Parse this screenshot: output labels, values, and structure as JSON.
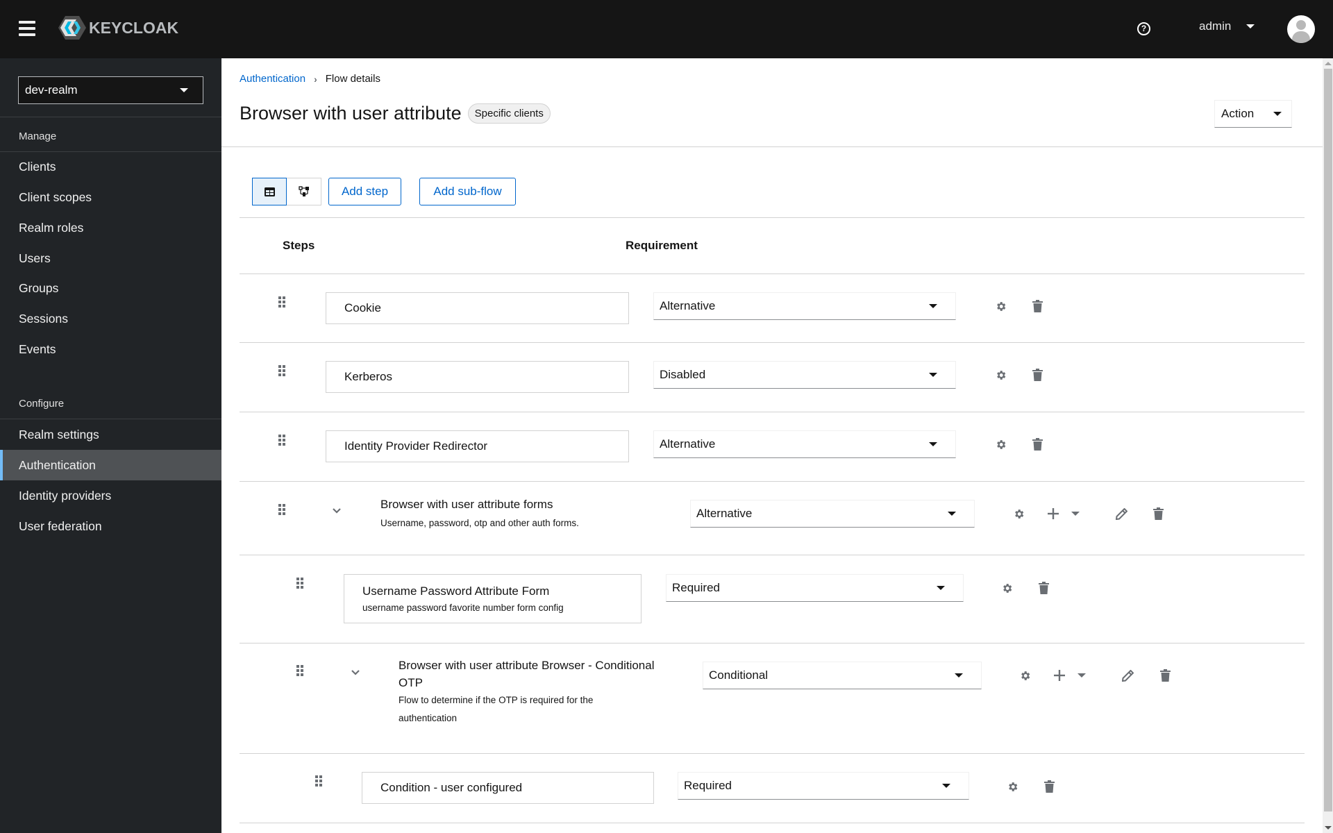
{
  "header": {
    "brand": "KEYCLOAK",
    "user": "admin",
    "icons": [
      "menu-icon",
      "help-icon",
      "avatar-icon"
    ]
  },
  "sidebar": {
    "realm": "dev-realm",
    "sections": [
      {
        "label": "Manage",
        "items": [
          "Clients",
          "Client scopes",
          "Realm roles",
          "Users",
          "Groups",
          "Sessions",
          "Events"
        ]
      },
      {
        "label": "Configure",
        "items": [
          "Realm settings",
          "Authentication",
          "Identity providers",
          "User federation"
        ]
      }
    ],
    "active_item": "Authentication"
  },
  "breadcrumb": {
    "parent": "Authentication",
    "current": "Flow details"
  },
  "page": {
    "title": "Browser with user attribute",
    "badge": "Specific clients",
    "action_label": "Action"
  },
  "toolbar": {
    "view_toggle": [
      "table-view",
      "diagram-view"
    ],
    "selected_view": "table-view",
    "add_step": "Add step",
    "add_subflow": "Add sub-flow"
  },
  "table": {
    "columns": [
      "Steps",
      "Requirement"
    ],
    "rows": [
      {
        "type": "step",
        "level": 0,
        "name": "Cookie",
        "requirement": "Alternative"
      },
      {
        "type": "step",
        "level": 0,
        "name": "Kerberos",
        "requirement": "Disabled"
      },
      {
        "type": "step",
        "level": 0,
        "name": "Identity Provider Redirector",
        "requirement": "Alternative"
      },
      {
        "type": "flow",
        "level": 0,
        "expanded": true,
        "name": "Browser with user attribute forms",
        "description": "Username, password, otp and other auth forms.",
        "requirement": "Alternative"
      },
      {
        "type": "step",
        "level": 1,
        "name": "Username Password Attribute Form",
        "description": "username password favorite number form config",
        "requirement": "Required"
      },
      {
        "type": "flow",
        "level": 1,
        "expanded": true,
        "name": "Browser with user attribute Browser - Conditional OTP",
        "name_line1": "Browser with user attribute Browser - Conditional",
        "name_line2": "OTP",
        "description": "Flow to determine if the OTP is required for the authentication",
        "description_line1": "Flow to determine if the OTP is required for the",
        "description_line2": "authentication",
        "requirement": "Conditional"
      },
      {
        "type": "step",
        "level": 2,
        "name": "Condition - user configured",
        "requirement": "Required"
      }
    ]
  },
  "colors": {
    "masthead": "#151515",
    "sidebar": "#212427",
    "sidebar_active": "#4f5255",
    "active_indicator": "#73bcf7",
    "link": "#0066cc",
    "icon_gray": "#6a6e73"
  }
}
